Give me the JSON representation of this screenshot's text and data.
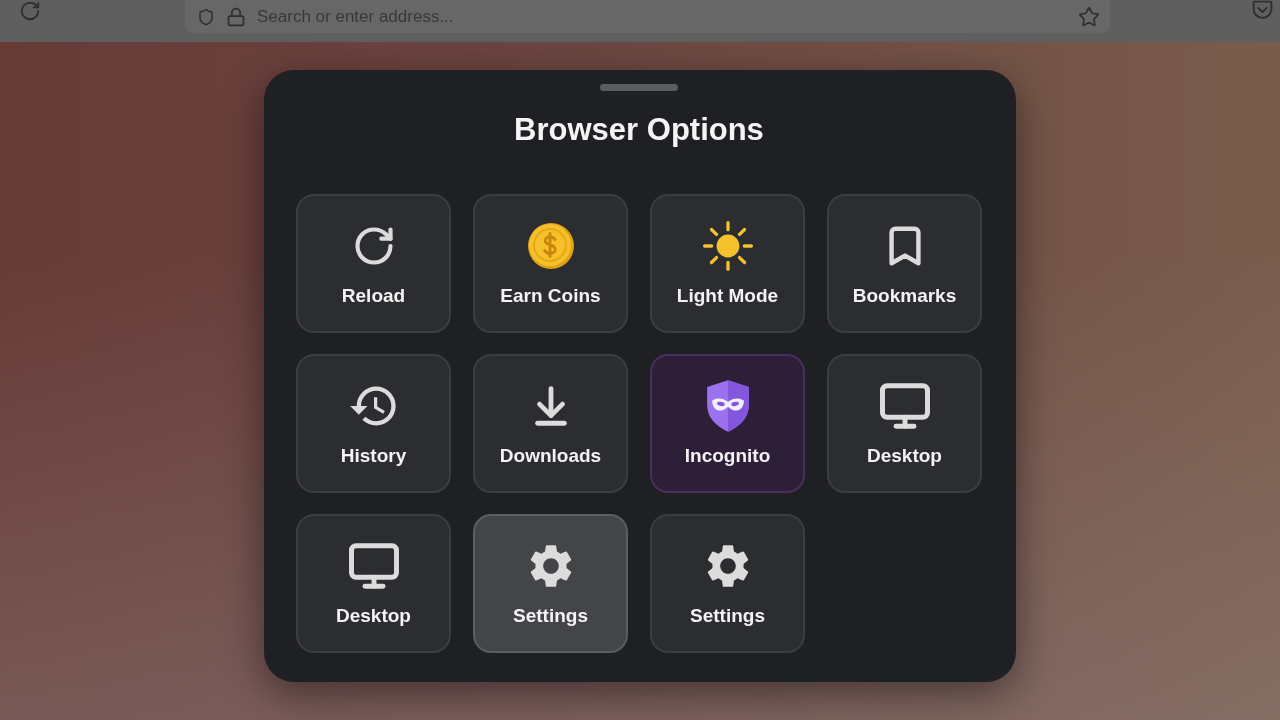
{
  "toolbar": {
    "address_bar": {
      "placeholder": "Search or enter address..."
    }
  },
  "sheet": {
    "title": "Browser Options",
    "options": [
      {
        "kind": "reload",
        "label": "Reload",
        "on": false,
        "pressed": false
      },
      {
        "kind": "coins",
        "label": "Earn Coins",
        "on": false,
        "pressed": false
      },
      {
        "kind": "theme",
        "label": "Light Mode",
        "on": false,
        "pressed": false
      },
      {
        "kind": "bookmarks",
        "label": "Bookmarks",
        "on": false,
        "pressed": false
      },
      {
        "kind": "history",
        "label": "History",
        "on": false,
        "pressed": false
      },
      {
        "kind": "downloads",
        "label": "Downloads",
        "on": false,
        "pressed": false
      },
      {
        "kind": "incognito",
        "label": "Incognito",
        "on": true,
        "pressed": false
      },
      {
        "kind": "desktop",
        "label": "Desktop",
        "on": false,
        "pressed": false
      },
      {
        "kind": "desktop",
        "label": "Desktop",
        "on": false,
        "pressed": false
      },
      {
        "kind": "settings",
        "label": "Settings",
        "on": false,
        "pressed": true
      },
      {
        "kind": "settings",
        "label": "Settings",
        "on": false,
        "pressed": false
      }
    ]
  }
}
